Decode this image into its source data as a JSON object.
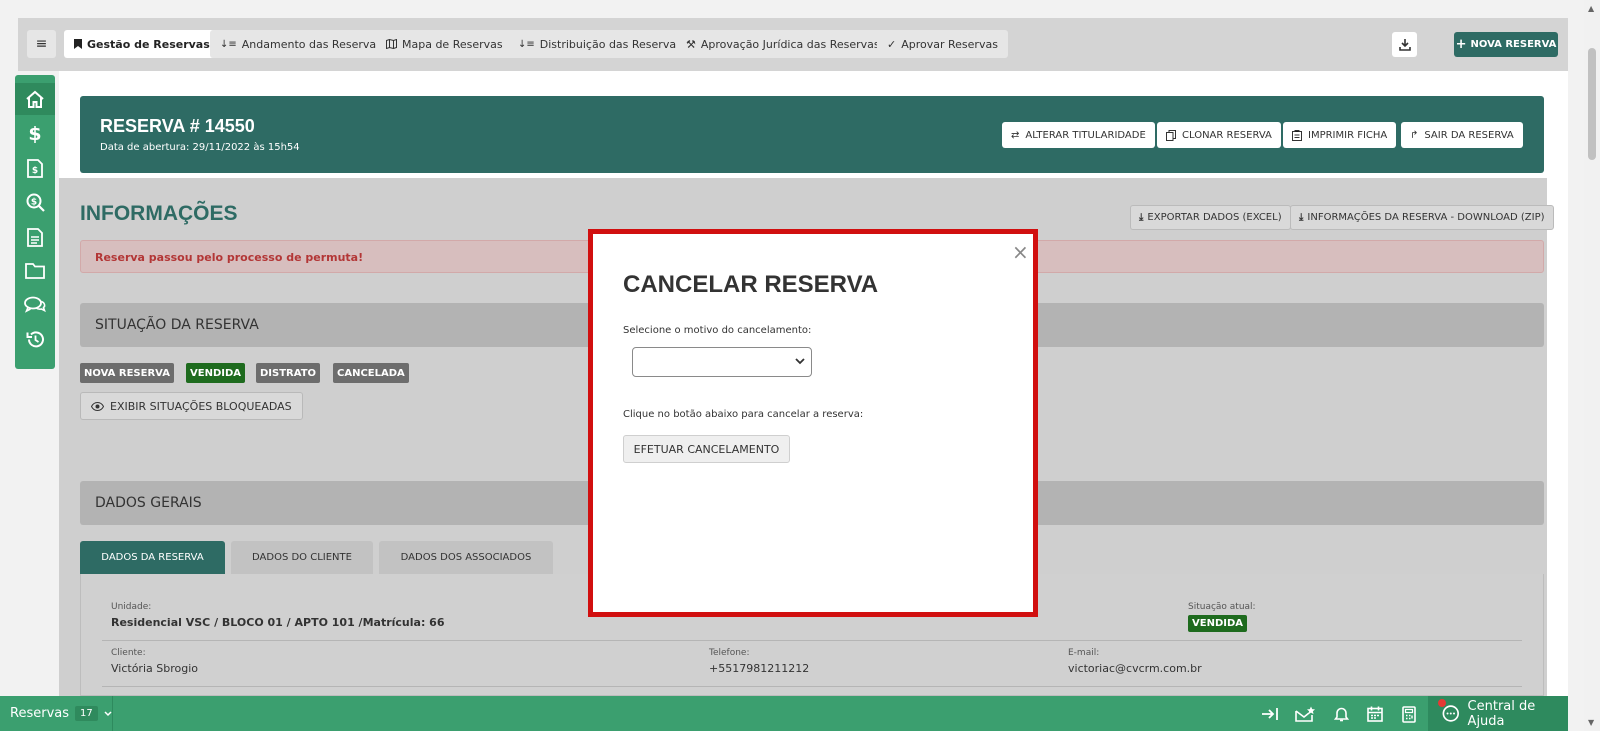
{
  "toolbar": {
    "menu_icon": "hamburger-icon",
    "tabs": [
      {
        "label": "Gestão de Reservas",
        "icon": "bookmark-icon"
      },
      {
        "label": "Andamento das Reservas",
        "icon": "sort-icon"
      },
      {
        "label": "Mapa de Reservas",
        "icon": "map-icon"
      },
      {
        "label": "Distribuição das Reservas",
        "icon": "sort-icon"
      },
      {
        "label": "Aprovação Jurídica das Reservas",
        "icon": "gavel-icon"
      },
      {
        "label": "Aprovar Reservas",
        "icon": "check-icon"
      }
    ],
    "download_icon": "download-icon",
    "new_label": "NOVA RESERVA"
  },
  "sidenav": [
    "home-icon",
    "dollar-icon",
    "invoice-icon",
    "search-dollar-icon",
    "document-icon",
    "folder-icon",
    "comments-icon",
    "history-icon"
  ],
  "header": {
    "title": "RESERVA # 14550",
    "subtitle": "Data de abertura: 29/11/2022 às 15h54",
    "buttons": [
      {
        "label": "ALTERAR TITULARIDADE",
        "icon": "swap-icon"
      },
      {
        "label": "CLONAR RESERVA",
        "icon": "copy-icon"
      },
      {
        "label": "IMPRIMIR FICHA",
        "icon": "clipboard-icon"
      },
      {
        "label": "SAIR DA RESERVA",
        "icon": "share-icon"
      }
    ]
  },
  "info": {
    "title": "INFORMAÇÕES",
    "export_excel": "EXPORTAR DADOS (EXCEL)",
    "export_zip": "INFORMAÇÕES DA RESERVA - DOWNLOAD (ZIP)",
    "alert": "Reserva passou pelo processo de permuta!"
  },
  "situacao": {
    "title": "SITUAÇÃO DA RESERVA",
    "badges": [
      {
        "label": "NOVA RESERVA",
        "color": "#6d6d6d"
      },
      {
        "label": "VENDIDA",
        "color": "#1e6b1e"
      },
      {
        "label": "DISTRATO",
        "color": "#6d6d6d"
      },
      {
        "label": "CANCELADA",
        "color": "#6d6d6d"
      }
    ],
    "show_blocked": "EXIBIR SITUAÇÕES BLOQUEADAS"
  },
  "dados": {
    "title": "DADOS GERAIS",
    "tabs": [
      "DADOS DA RESERVA",
      "DADOS DO CLIENTE",
      "DADOS DOS ASSOCIADOS"
    ],
    "unidade_label": "Unidade:",
    "unidade": "Residencial VSC / BLOCO 01 / APTO 101 /Matrícula: 66",
    "situacao_label": "Situação atual:",
    "situacao": "VENDIDA",
    "cliente_label": "Cliente:",
    "cliente": "Victória Sbrogio",
    "telefone_label": "Telefone:",
    "telefone": "+5517981211212",
    "email_label": "E-mail:",
    "email": "victoriac@cvcrm.com.br"
  },
  "modal": {
    "title": "CANCELAR RESERVA",
    "select_label": "Selecione o motivo do cancelamento:",
    "select_value": "",
    "action_label": "Clique no botão abaixo para cancelar a reserva:",
    "button": "EFETUAR CANCELAMENTO",
    "close": "×"
  },
  "bottombar": {
    "label": "Reservas",
    "count": "17",
    "icons": [
      "sign-in-icon",
      "mail-star-icon",
      "bell-icon",
      "calendar-icon",
      "calculator-icon"
    ],
    "help": "Central de Ajuda"
  },
  "colors": {
    "accent": "#2e6b64",
    "green": "#3b9f6f",
    "alert_red": "#d10f0f"
  }
}
